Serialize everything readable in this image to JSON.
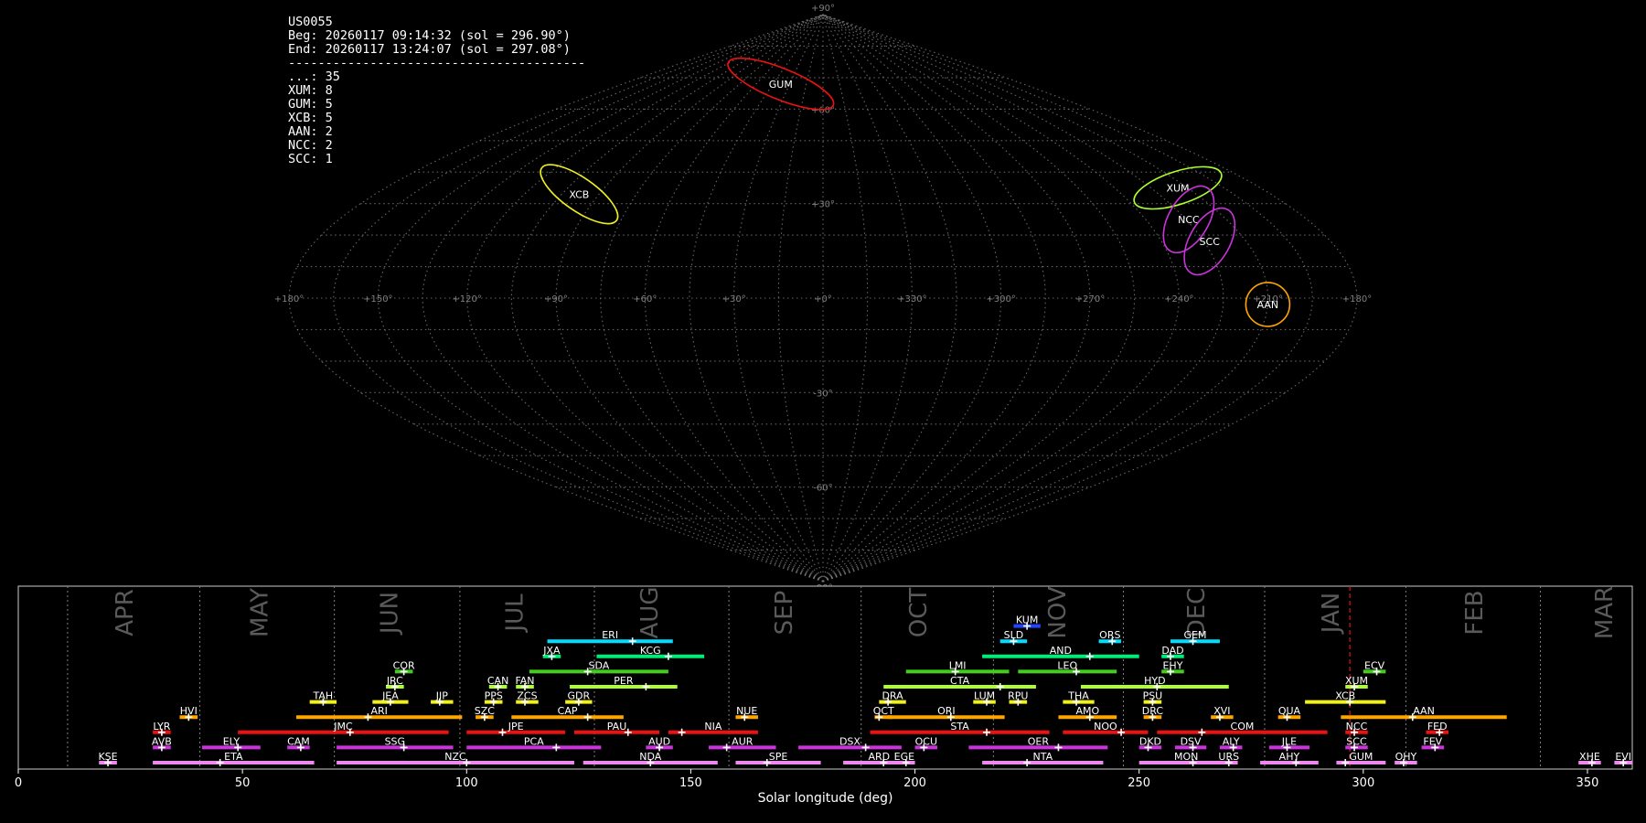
{
  "info": {
    "station": "US0055",
    "beg": "Beg: 20260117 09:14:32 (sol = 296.90°)",
    "end": "End: 20260117 13:24:07 (sol = 297.08°)",
    "separator": "----------------------------------------",
    "counts": [
      "...: 35",
      "XUM: 8",
      "GUM: 5",
      "XCB: 5",
      "AAN: 2",
      "NCC: 2",
      "SCC: 1"
    ]
  },
  "colors": {
    "red": "#ee1111",
    "orange": "#ffa500",
    "yellow": "#f0f020",
    "lime": "#adff2f",
    "green": "#44cc22",
    "spring": "#00ee77",
    "cyan": "#00ddff",
    "blue": "#2244ff",
    "violet": "#cc33dd",
    "pink": "#ee88ee",
    "grid": "#808080"
  },
  "chart_data": [
    {
      "type": "scatter",
      "projection": "sinusoidal sky map",
      "lon_ticks": [
        "+180°",
        "+150°",
        "+120°",
        "+90°",
        "+60°",
        "+30°",
        "+0°",
        "+330°",
        "+300°",
        "+270°",
        "+240°",
        "+210°",
        "+180°"
      ],
      "lat_ticks": [
        "+90°",
        "+60°",
        "+30°",
        "-30°",
        "-60°",
        "-90°"
      ],
      "radiants": [
        {
          "code": "GUM",
          "lon": 322,
          "lat": 68,
          "color": "red"
        },
        {
          "code": "XUM",
          "lon": 146,
          "lat": 35,
          "color": "lime"
        },
        {
          "code": "XCB",
          "lon": 262,
          "lat": 33,
          "color": "yellow"
        },
        {
          "code": "NCC",
          "lon": 136,
          "lat": 25,
          "color": "violet"
        },
        {
          "code": "SCC",
          "lon": 137,
          "lat": 18,
          "color": "violet"
        },
        {
          "code": "AAN",
          "lon": 150,
          "lat": -2,
          "color": "orange"
        }
      ]
    },
    {
      "type": "gantt",
      "xlabel": "Solar longitude (deg)",
      "xlim": [
        0,
        360
      ],
      "x_ticks": [
        0,
        50,
        100,
        150,
        200,
        250,
        300,
        350
      ],
      "month_boundaries": [
        11,
        40.5,
        70.5,
        98.5,
        128.5,
        158.5,
        188,
        217.5,
        246.5,
        278,
        309.5,
        339.5
      ],
      "months": [
        {
          "name": "APR",
          "x": 24
        },
        {
          "name": "MAY",
          "x": 54
        },
        {
          "name": "JUN",
          "x": 83
        },
        {
          "name": "JUL",
          "x": 111
        },
        {
          "name": "AUG",
          "x": 141
        },
        {
          "name": "SEP",
          "x": 171
        },
        {
          "name": "OCT",
          "x": 201
        },
        {
          "name": "NOV",
          "x": 232
        },
        {
          "name": "DEC",
          "x": 263
        },
        {
          "name": "JAN",
          "x": 293
        },
        {
          "name": "FEB",
          "x": 325
        },
        {
          "name": "MAR",
          "x": 354
        }
      ],
      "current_sol": 297,
      "showers": [
        {
          "code": "KSE",
          "start": 18,
          "end": 22,
          "peak": 20,
          "row": 0,
          "color": "pink"
        },
        {
          "code": "ETA",
          "start": 30,
          "end": 66,
          "peak": 45,
          "row": 0,
          "color": "pink"
        },
        {
          "code": "NZC",
          "start": 71,
          "end": 124,
          "peak": 100,
          "row": 0,
          "color": "pink"
        },
        {
          "code": "NDA",
          "start": 126,
          "end": 156,
          "peak": 141,
          "row": 0,
          "color": "pink"
        },
        {
          "code": "SPE",
          "start": 160,
          "end": 179,
          "peak": 167,
          "row": 0,
          "color": "pink"
        },
        {
          "code": "ARD",
          "start": 184,
          "end": 200,
          "peak": 193,
          "row": 0,
          "color": "pink"
        },
        {
          "code": "EGE",
          "start": 197,
          "end": 197,
          "peak": 198,
          "row": 0,
          "color": "pink"
        },
        {
          "code": "NTA",
          "start": 215,
          "end": 242,
          "peak": 225,
          "row": 0,
          "color": "pink"
        },
        {
          "code": "MON",
          "start": 250,
          "end": 271,
          "peak": 262,
          "row": 0,
          "color": "pink"
        },
        {
          "code": "URS",
          "start": 268,
          "end": 272,
          "peak": 270,
          "row": 0,
          "color": "pink"
        },
        {
          "code": "AHY",
          "start": 277,
          "end": 290,
          "peak": 285,
          "row": 0,
          "color": "pink"
        },
        {
          "code": "GUM",
          "start": 294,
          "end": 305,
          "peak": 296,
          "row": 0,
          "color": "pink"
        },
        {
          "code": "OHY",
          "start": 307,
          "end": 312,
          "peak": 309,
          "row": 0,
          "color": "pink"
        },
        {
          "code": "XHE",
          "start": 348,
          "end": 353,
          "peak": 351,
          "row": 0,
          "color": "pink"
        },
        {
          "code": "EVI",
          "start": 356,
          "end": 360,
          "peak": 358,
          "row": 0,
          "color": "pink"
        },
        {
          "code": "AVB",
          "start": 30,
          "end": 34,
          "peak": 32,
          "row": 1,
          "color": "violet"
        },
        {
          "code": "ELY",
          "start": 41,
          "end": 54,
          "peak": 49,
          "row": 1,
          "color": "violet"
        },
        {
          "code": "CAM",
          "start": 60,
          "end": 65,
          "peak": 63,
          "row": 1,
          "color": "violet"
        },
        {
          "code": "SSG",
          "start": 71,
          "end": 97,
          "peak": 86,
          "row": 1,
          "color": "violet"
        },
        {
          "code": "PCA",
          "start": 100,
          "end": 130,
          "peak": 120,
          "row": 1,
          "color": "violet"
        },
        {
          "code": "AUD",
          "start": 140,
          "end": 146,
          "peak": 143,
          "row": 1,
          "color": "violet"
        },
        {
          "code": "AUR",
          "start": 154,
          "end": 169,
          "peak": 158,
          "row": 1,
          "color": "violet"
        },
        {
          "code": "DSX",
          "start": 174,
          "end": 197,
          "peak": 189,
          "row": 1,
          "color": "violet"
        },
        {
          "code": "OCU",
          "start": 200,
          "end": 205,
          "peak": 202,
          "row": 1,
          "color": "violet"
        },
        {
          "code": "OER",
          "start": 212,
          "end": 243,
          "peak": 232,
          "row": 1,
          "color": "violet"
        },
        {
          "code": "DKD",
          "start": 250,
          "end": 255,
          "peak": 252,
          "row": 1,
          "color": "violet"
        },
        {
          "code": "DSV",
          "start": 258,
          "end": 265,
          "peak": 262,
          "row": 1,
          "color": "violet"
        },
        {
          "code": "ALY",
          "start": 268,
          "end": 273,
          "peak": 271,
          "row": 1,
          "color": "violet"
        },
        {
          "code": "JLE",
          "start": 279,
          "end": 288,
          "peak": 283,
          "row": 1,
          "color": "violet"
        },
        {
          "code": "SCC",
          "start": 296,
          "end": 301,
          "peak": 298,
          "row": 1,
          "color": "violet"
        },
        {
          "code": "FEV",
          "start": 313,
          "end": 318,
          "peak": 316,
          "row": 1,
          "color": "violet"
        },
        {
          "code": "LYR",
          "start": 30,
          "end": 34,
          "peak": 32,
          "row": 2,
          "color": "red"
        },
        {
          "code": "JMC",
          "start": 49,
          "end": 96,
          "peak": 74,
          "row": 2,
          "color": "red"
        },
        {
          "code": "JPE",
          "start": 100,
          "end": 122,
          "peak": 108,
          "row": 2,
          "color": "red"
        },
        {
          "code": "PAU",
          "start": 124,
          "end": 143,
          "peak": 136,
          "row": 2,
          "color": "red"
        },
        {
          "code": "NIA",
          "start": 145,
          "end": 165,
          "peak": 148,
          "row": 2,
          "color": "red"
        },
        {
          "code": "STA",
          "start": 190,
          "end": 230,
          "peak": 216,
          "row": 2,
          "color": "red"
        },
        {
          "code": "NOO",
          "start": 233,
          "end": 252,
          "peak": 246,
          "row": 2,
          "color": "red"
        },
        {
          "code": "COM",
          "start": 254,
          "end": 292,
          "peak": 264,
          "row": 2,
          "color": "red"
        },
        {
          "code": "NCC",
          "start": 296,
          "end": 301,
          "peak": 298,
          "row": 2,
          "color": "red"
        },
        {
          "code": "FED",
          "start": 314,
          "end": 319,
          "peak": 317,
          "row": 2,
          "color": "red"
        },
        {
          "code": "HVI",
          "start": 36,
          "end": 40,
          "peak": 38,
          "row": 3,
          "color": "orange"
        },
        {
          "code": "ARI",
          "start": 62,
          "end": 99,
          "peak": 78,
          "row": 3,
          "color": "orange"
        },
        {
          "code": "SZC",
          "start": 102,
          "end": 106,
          "peak": 104,
          "row": 3,
          "color": "orange"
        },
        {
          "code": "CAP",
          "start": 110,
          "end": 135,
          "peak": 127,
          "row": 3,
          "color": "orange"
        },
        {
          "code": "NUE",
          "start": 160,
          "end": 165,
          "peak": 162,
          "row": 3,
          "color": "orange"
        },
        {
          "code": "OCT",
          "start": 191,
          "end": 195,
          "peak": 192,
          "row": 3,
          "color": "orange"
        },
        {
          "code": "ORI",
          "start": 194,
          "end": 220,
          "peak": 208,
          "row": 3,
          "color": "orange"
        },
        {
          "code": "AMO",
          "start": 232,
          "end": 245,
          "peak": 239,
          "row": 3,
          "color": "orange"
        },
        {
          "code": "DRC",
          "start": 251,
          "end": 255,
          "peak": 253,
          "row": 3,
          "color": "orange"
        },
        {
          "code": "XVI",
          "start": 266,
          "end": 271,
          "peak": 268,
          "row": 3,
          "color": "orange"
        },
        {
          "code": "QUA",
          "start": 281,
          "end": 286,
          "peak": 283,
          "row": 3,
          "color": "orange"
        },
        {
          "code": "AAN",
          "start": 295,
          "end": 332,
          "peak": 311,
          "row": 3,
          "color": "orange"
        },
        {
          "code": "TAH",
          "start": 65,
          "end": 71,
          "peak": 68,
          "row": 4,
          "color": "yellow"
        },
        {
          "code": "JEA",
          "start": 79,
          "end": 87,
          "peak": 83,
          "row": 4,
          "color": "yellow"
        },
        {
          "code": "JIP",
          "start": 92,
          "end": 97,
          "peak": 94,
          "row": 4,
          "color": "yellow"
        },
        {
          "code": "PPS",
          "start": 104,
          "end": 108,
          "peak": 106,
          "row": 4,
          "color": "yellow"
        },
        {
          "code": "ZCS",
          "start": 111,
          "end": 116,
          "peak": 113,
          "row": 4,
          "color": "yellow"
        },
        {
          "code": "GDR",
          "start": 122,
          "end": 128,
          "peak": 125,
          "row": 4,
          "color": "yellow"
        },
        {
          "code": "DRA",
          "start": 192,
          "end": 198,
          "peak": 194,
          "row": 4,
          "color": "yellow"
        },
        {
          "code": "LUM",
          "start": 213,
          "end": 218,
          "peak": 216,
          "row": 4,
          "color": "yellow"
        },
        {
          "code": "RPU",
          "start": 221,
          "end": 225,
          "peak": 223,
          "row": 4,
          "color": "yellow"
        },
        {
          "code": "THA",
          "start": 233,
          "end": 240,
          "peak": 236,
          "row": 4,
          "color": "yellow"
        },
        {
          "code": "PSU",
          "start": 251,
          "end": 255,
          "peak": 253,
          "row": 4,
          "color": "yellow"
        },
        {
          "code": "XCB",
          "start": 287,
          "end": 305,
          "peak": 297,
          "row": 4,
          "color": "yellow"
        },
        {
          "code": "JRC",
          "start": 82,
          "end": 86,
          "peak": 84,
          "row": 5,
          "color": "lime"
        },
        {
          "code": "CAN",
          "start": 105,
          "end": 109,
          "peak": 107,
          "row": 5,
          "color": "lime"
        },
        {
          "code": "FAN",
          "start": 111,
          "end": 115,
          "peak": 113,
          "row": 5,
          "color": "lime"
        },
        {
          "code": "PER",
          "start": 123,
          "end": 147,
          "peak": 140,
          "row": 5,
          "color": "lime"
        },
        {
          "code": "CTA",
          "start": 193,
          "end": 227,
          "peak": 219,
          "row": 5,
          "color": "lime"
        },
        {
          "code": "HYD",
          "start": 237,
          "end": 270,
          "peak": 254,
          "row": 5,
          "color": "lime"
        },
        {
          "code": "XUM",
          "start": 296,
          "end": 301,
          "peak": 298,
          "row": 5,
          "color": "lime"
        },
        {
          "code": "COR",
          "start": 84,
          "end": 88,
          "peak": 86,
          "row": 6,
          "color": "green"
        },
        {
          "code": "SDA",
          "start": 114,
          "end": 145,
          "peak": 127,
          "row": 6,
          "color": "green"
        },
        {
          "code": "LMI",
          "start": 198,
          "end": 221,
          "peak": 209,
          "row": 6,
          "color": "green"
        },
        {
          "code": "LEO",
          "start": 223,
          "end": 245,
          "peak": 236,
          "row": 6,
          "color": "green"
        },
        {
          "code": "EHY",
          "start": 255,
          "end": 260,
          "peak": 257,
          "row": 6,
          "color": "green"
        },
        {
          "code": "ECV",
          "start": 300,
          "end": 305,
          "peak": 303,
          "row": 6,
          "color": "green"
        },
        {
          "code": "JXA",
          "start": 117,
          "end": 121,
          "peak": 119,
          "row": 7,
          "color": "spring"
        },
        {
          "code": "KCG",
          "start": 129,
          "end": 153,
          "peak": 145,
          "row": 7,
          "color": "spring"
        },
        {
          "code": "AND",
          "start": 215,
          "end": 250,
          "peak": 239,
          "row": 7,
          "color": "spring"
        },
        {
          "code": "DAD",
          "start": 255,
          "end": 260,
          "peak": 257,
          "row": 7,
          "color": "spring"
        },
        {
          "code": "ERI",
          "start": 118,
          "end": 146,
          "peak": 137,
          "row": 8,
          "color": "cyan"
        },
        {
          "code": "SLD",
          "start": 219,
          "end": 225,
          "peak": 222,
          "row": 8,
          "color": "cyan"
        },
        {
          "code": "ORS",
          "start": 241,
          "end": 246,
          "peak": 244,
          "row": 8,
          "color": "cyan"
        },
        {
          "code": "GEM",
          "start": 257,
          "end": 268,
          "peak": 262,
          "row": 8,
          "color": "cyan"
        },
        {
          "code": "KUM",
          "start": 222,
          "end": 228,
          "peak": 225,
          "row": 9,
          "color": "blue"
        }
      ]
    }
  ]
}
